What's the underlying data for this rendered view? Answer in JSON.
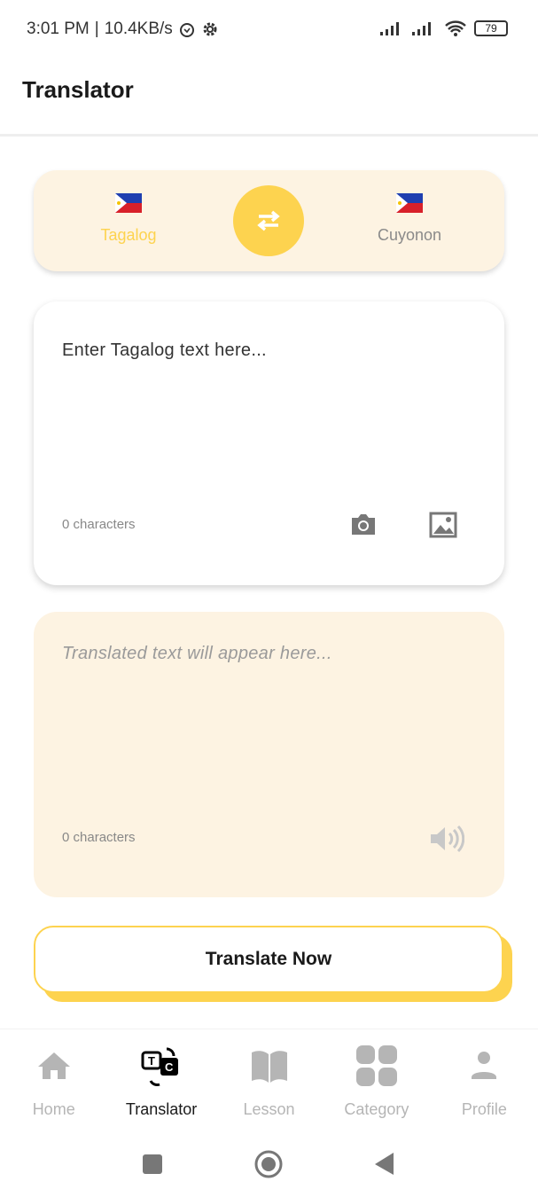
{
  "status_bar": {
    "time": "3:01 PM",
    "speed": "10.4KB/s",
    "battery": "79",
    "icons": [
      "alarm-icon",
      "settings-icon",
      "signal-icon",
      "signal-icon",
      "wifi-icon",
      "battery-icon"
    ]
  },
  "header": {
    "title": "Translator"
  },
  "language_selector": {
    "source": "Tagalog",
    "target": "Cuyonon",
    "active_color": "#fdd34f",
    "inactive_color": "#8a8a8a",
    "swap_icon": "swap-arrows-icon"
  },
  "input": {
    "placeholder": "Enter Tagalog text here...",
    "count": "0 characters",
    "icons": [
      "camera-icon",
      "image-icon"
    ]
  },
  "output": {
    "placeholder": "Translated text will appear here...",
    "count": "0 characters",
    "icons": [
      "speaker-icon"
    ]
  },
  "translate_button": {
    "label": "Translate Now"
  },
  "nav": {
    "items": [
      {
        "label": "Home",
        "icon": "home-icon"
      },
      {
        "label": "Translator",
        "icon": "translator-icon",
        "active": true
      },
      {
        "label": "Lesson",
        "icon": "book-icon"
      },
      {
        "label": "Category",
        "icon": "grid-icon"
      },
      {
        "label": "Profile",
        "icon": "person-icon"
      }
    ]
  },
  "colors": {
    "accent": "#fdd34f",
    "card_bg": "#fdf3e2"
  }
}
